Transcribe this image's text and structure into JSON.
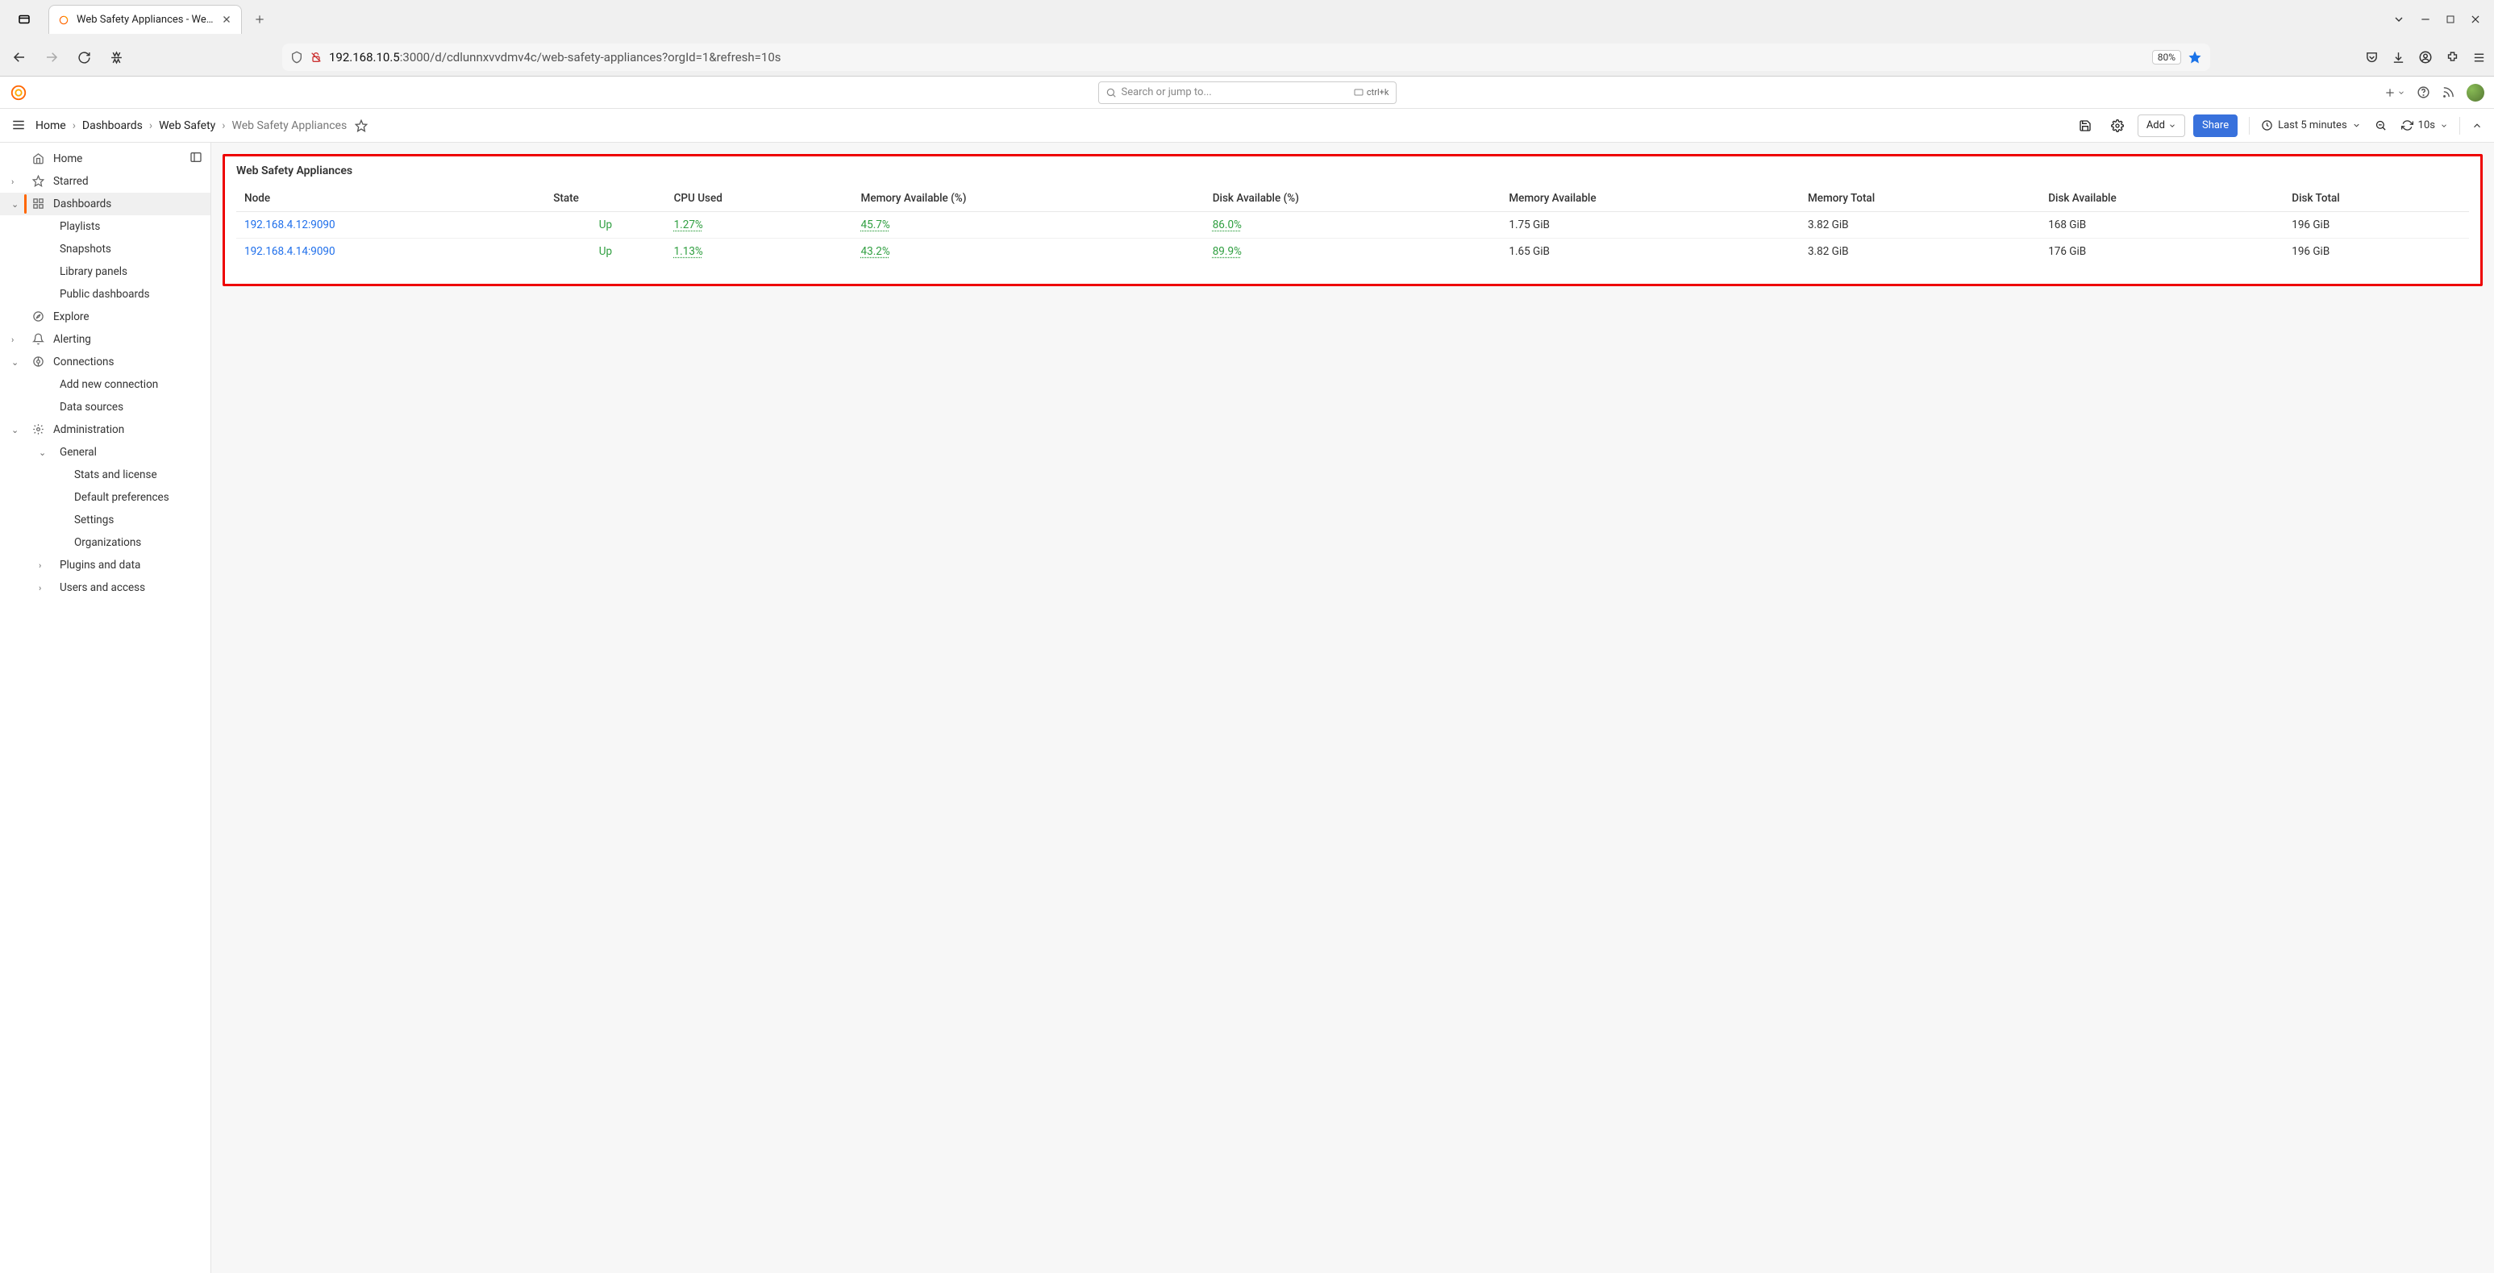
{
  "browser": {
    "tab_title": "Web Safety Appliances - Web S",
    "url_host": "192.168.10.5",
    "url_rest": ":3000/d/cdlunnxvvdmv4c/web-safety-appliances?orgId=1&refresh=10s",
    "zoom": "80%"
  },
  "search": {
    "placeholder": "Search or jump to...",
    "shortcut": "ctrl+k"
  },
  "breadcrumbs": {
    "items": [
      "Home",
      "Dashboards",
      "Web Safety",
      "Web Safety Appliances"
    ]
  },
  "toolbar": {
    "add_label": "Add",
    "share_label": "Share",
    "time_label": "Last 5 minutes",
    "refresh_interval": "10s"
  },
  "sidebar": {
    "items": [
      {
        "label": "Home"
      },
      {
        "label": "Starred"
      },
      {
        "label": "Dashboards"
      },
      {
        "label": "Playlists"
      },
      {
        "label": "Snapshots"
      },
      {
        "label": "Library panels"
      },
      {
        "label": "Public dashboards"
      },
      {
        "label": "Explore"
      },
      {
        "label": "Alerting"
      },
      {
        "label": "Connections"
      },
      {
        "label": "Add new connection"
      },
      {
        "label": "Data sources"
      },
      {
        "label": "Administration"
      },
      {
        "label": "General"
      },
      {
        "label": "Stats and license"
      },
      {
        "label": "Default preferences"
      },
      {
        "label": "Settings"
      },
      {
        "label": "Organizations"
      },
      {
        "label": "Plugins and data"
      },
      {
        "label": "Users and access"
      }
    ]
  },
  "panel": {
    "title": "Web Safety Appliances",
    "columns": [
      "Node",
      "State",
      "CPU Used",
      "Memory Available (%)",
      "Disk Available (%)",
      "Memory Available",
      "Memory Total",
      "Disk Available",
      "Disk Total"
    ],
    "rows": [
      {
        "node": "192.168.4.12:9090",
        "state": "Up",
        "cpu": "1.27%",
        "mem_pct": "45.7%",
        "disk_pct": "86.0%",
        "mem_avail": "1.75 GiB",
        "mem_total": "3.82 GiB",
        "disk_avail": "168 GiB",
        "disk_total": "196 GiB"
      },
      {
        "node": "192.168.4.14:9090",
        "state": "Up",
        "cpu": "1.13%",
        "mem_pct": "43.2%",
        "disk_pct": "89.9%",
        "mem_avail": "1.65 GiB",
        "mem_total": "3.82 GiB",
        "disk_avail": "176 GiB",
        "disk_total": "196 GiB"
      }
    ]
  }
}
